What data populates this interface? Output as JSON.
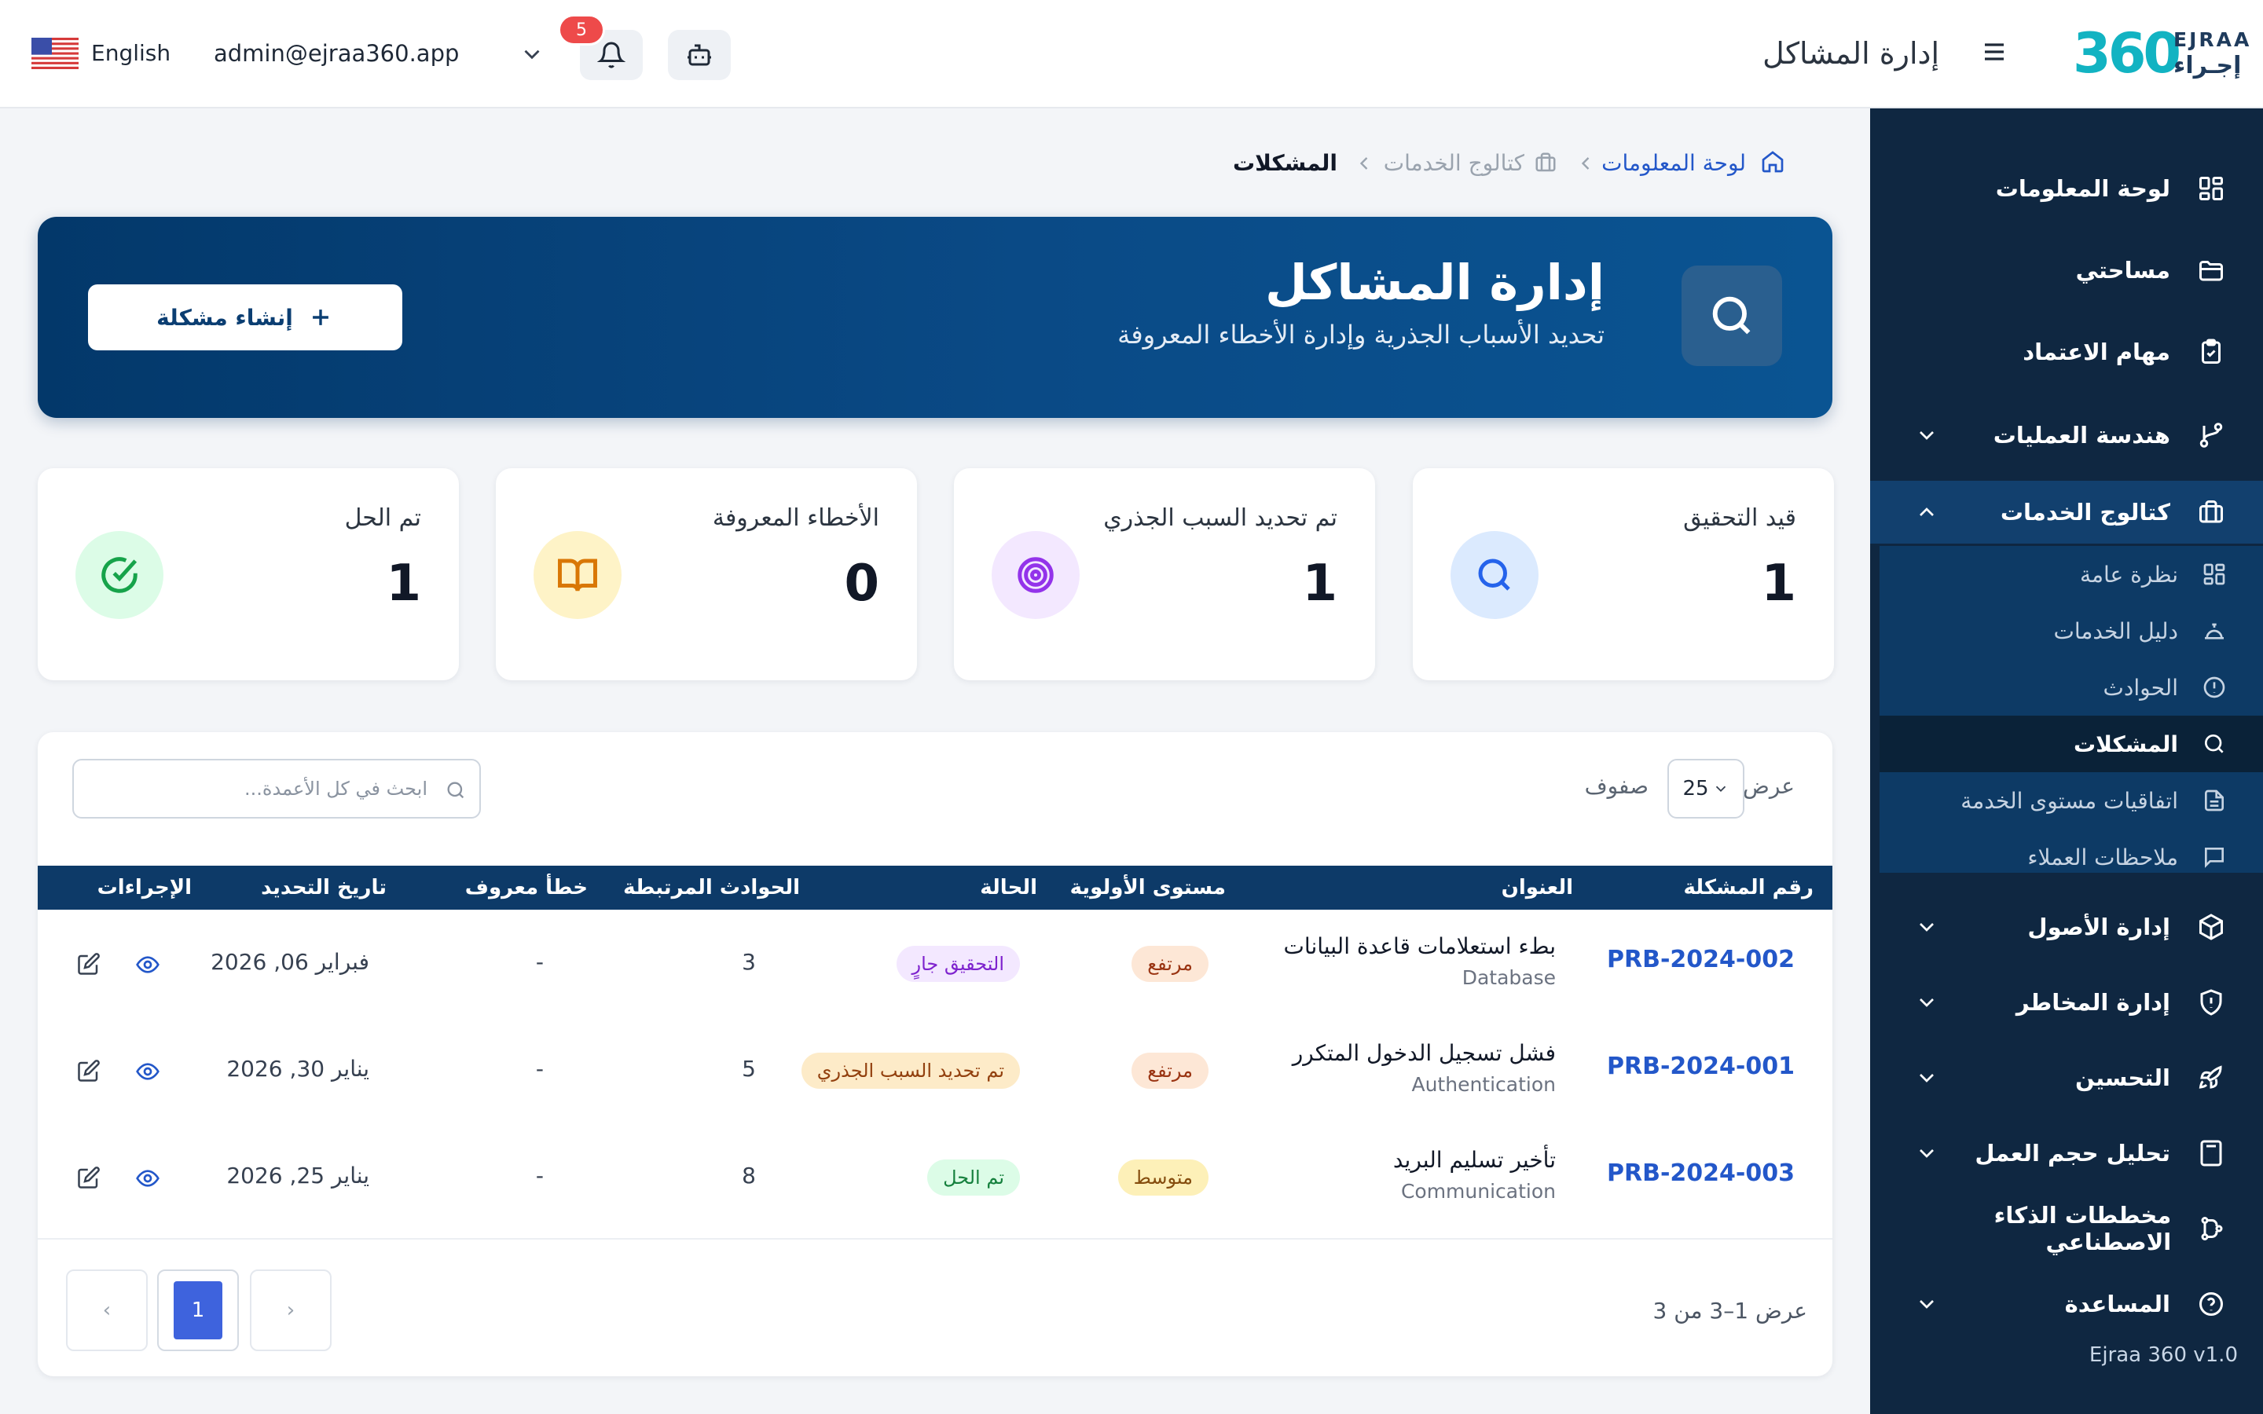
{
  "topbar": {
    "language": "English",
    "email": "admin@ejraa360.app",
    "notification_count": "5",
    "page_title": "إدارة المشاكل",
    "logo_number": "360",
    "logo_en": "EJRAA",
    "logo_ar": "إجـراء"
  },
  "sidebar": {
    "items": [
      {
        "label": "لوحة المعلومات",
        "icon": "grid-icon"
      },
      {
        "label": "مساحتي",
        "icon": "folder-icon"
      },
      {
        "label": "مهام الاعتماد",
        "icon": "clipboard-check-icon"
      },
      {
        "label": "هندسة العمليات",
        "icon": "git-branch-icon"
      },
      {
        "label": "كتالوج الخدمات",
        "icon": "briefcase-icon"
      },
      {
        "label": "إدارة الأصول",
        "icon": "box-icon"
      },
      {
        "label": "إدارة المخاطر",
        "icon": "shield-icon"
      },
      {
        "label": "التحسين",
        "icon": "rocket-icon"
      },
      {
        "label": "تحليل حجم العمل",
        "icon": "calculator-icon"
      },
      {
        "label": "مخططات الذكاء الاصطناعي",
        "icon": "workflow-icon"
      },
      {
        "label": "المساعدة",
        "icon": "help-icon"
      }
    ],
    "sub_items": [
      {
        "label": "نظرة عامة",
        "icon": "grid-icon"
      },
      {
        "label": "دليل الخدمات",
        "icon": "bell-service-icon"
      },
      {
        "label": "الحوادث",
        "icon": "alert-circle-icon"
      },
      {
        "label": "المشكلات",
        "icon": "search-icon"
      },
      {
        "label": "اتفاقيات مستوى الخدمة",
        "icon": "file-text-icon"
      },
      {
        "label": "ملاحظات العملاء",
        "icon": "message-icon"
      }
    ],
    "version": "Ejraa 360 v1.0"
  },
  "breadcrumb": {
    "home": "لوحة المعلومات",
    "catalog": "كتالوج الخدمات",
    "current": "المشكلات"
  },
  "hero": {
    "title": "إدارة المشاكل",
    "subtitle": "تحديد الأسباب الجذرية وإدارة الأخطاء المعروفة",
    "create_button": "إنشاء مشكلة"
  },
  "stats": [
    {
      "label": "قيد التحقيق",
      "value": "1",
      "color": "#2563eb",
      "bg": "#dbeafe"
    },
    {
      "label": "تم تحديد السبب الجذري",
      "value": "1",
      "color": "#9333ea",
      "bg": "#f3e8ff"
    },
    {
      "label": "الأخطاء المعروفة",
      "value": "0",
      "color": "#d97706",
      "bg": "#fef3c7"
    },
    {
      "label": "تم الحل",
      "value": "1",
      "color": "#16a34a",
      "bg": "#dcfce7"
    }
  ],
  "table": {
    "search_placeholder": "ابحث في كل الأعمدة...",
    "show_label": "عرض",
    "page_size": "25",
    "rows_label": "صفوف",
    "headers": {
      "id": "رقم المشكلة",
      "title": "العنوان",
      "priority": "مستوى الأولوية",
      "status": "الحالة",
      "incidents": "الحوادث المرتبطة",
      "known_error": "خطأ معروف",
      "updated": "تاريخ التحديد",
      "actions": "الإجراءات"
    },
    "rows": [
      {
        "id": "PRB-2024-002",
        "title": "بطء استعلامات قاعدة البيانات",
        "category": "Database",
        "priority": "مرتفع",
        "status": "التحقيق جارٍ",
        "incidents": "3",
        "known_error": "-",
        "date": "فبراير 06, 2026"
      },
      {
        "id": "PRB-2024-001",
        "title": "فشل تسجيل الدخول المتكرر",
        "category": "Authentication",
        "priority": "مرتفع",
        "status": "تم تحديد السبب الجذري",
        "incidents": "5",
        "known_error": "-",
        "date": "يناير 30, 2026"
      },
      {
        "id": "PRB-2024-003",
        "title": "تأخير تسليم البريد",
        "category": "Communication",
        "priority": "متوسط",
        "status": "تم الحل",
        "incidents": "8",
        "known_error": "-",
        "date": "يناير 25, 2026"
      }
    ],
    "pagination": {
      "prev": "‹",
      "page": "1",
      "next": "›",
      "info": "عرض 1–3 من 3"
    }
  }
}
